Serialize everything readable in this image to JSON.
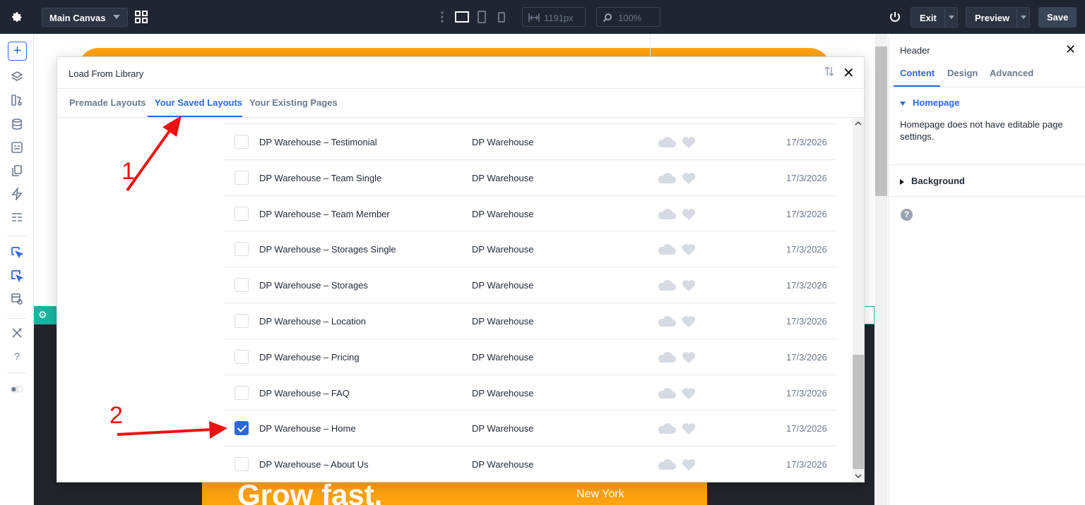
{
  "topbar": {
    "canvas_label": "Main Canvas",
    "width_value": "1191px",
    "zoom_value": "100%",
    "exit_label": "Exit",
    "preview_label": "Preview",
    "save_label": "Save"
  },
  "modal": {
    "title": "Load From Library",
    "tabs": [
      {
        "label": "Premade Layouts"
      },
      {
        "label": "Your Saved Layouts"
      },
      {
        "label": "Your Existing Pages"
      }
    ],
    "rows": [
      {
        "name": "DP Warehouse – Testimonial",
        "category": "DP Warehouse",
        "date": "17/3/2026",
        "checked": false
      },
      {
        "name": "DP Warehouse – Team Single",
        "category": "DP Warehouse",
        "date": "17/3/2026",
        "checked": false
      },
      {
        "name": "DP Warehouse – Team Member",
        "category": "DP Warehouse",
        "date": "17/3/2026",
        "checked": false
      },
      {
        "name": "DP Warehouse – Storages Single",
        "category": "DP Warehouse",
        "date": "17/3/2026",
        "checked": false
      },
      {
        "name": "DP Warehouse – Storages",
        "category": "DP Warehouse",
        "date": "17/3/2026",
        "checked": false
      },
      {
        "name": "DP Warehouse – Location",
        "category": "DP Warehouse",
        "date": "17/3/2026",
        "checked": false
      },
      {
        "name": "DP Warehouse – Pricing",
        "category": "DP Warehouse",
        "date": "17/3/2026",
        "checked": false
      },
      {
        "name": "DP Warehouse – FAQ",
        "category": "DP Warehouse",
        "date": "17/3/2026",
        "checked": false
      },
      {
        "name": "DP Warehouse – Home",
        "category": "DP Warehouse",
        "date": "17/3/2026",
        "checked": true
      },
      {
        "name": "DP Warehouse – About Us",
        "category": "DP Warehouse",
        "date": "17/3/2026",
        "checked": false
      }
    ]
  },
  "panel": {
    "title": "Header",
    "tabs": [
      {
        "label": "Content"
      },
      {
        "label": "Design"
      },
      {
        "label": "Advanced"
      }
    ],
    "section_homepage": "Homepage",
    "homepage_note": "Homepage does not have editable page settings.",
    "section_background": "Background",
    "help_glyph": "?"
  },
  "canvas": {
    "hero_text": "Grow fast.",
    "hero_sub": "New York"
  },
  "annotations": {
    "one": "1",
    "two": "2"
  },
  "colors": {
    "accent": "#2b68e0",
    "topbar": "#1f2632",
    "orange": "#ffa210",
    "teal": "#18b5a0",
    "arrow": "#ee1111"
  }
}
